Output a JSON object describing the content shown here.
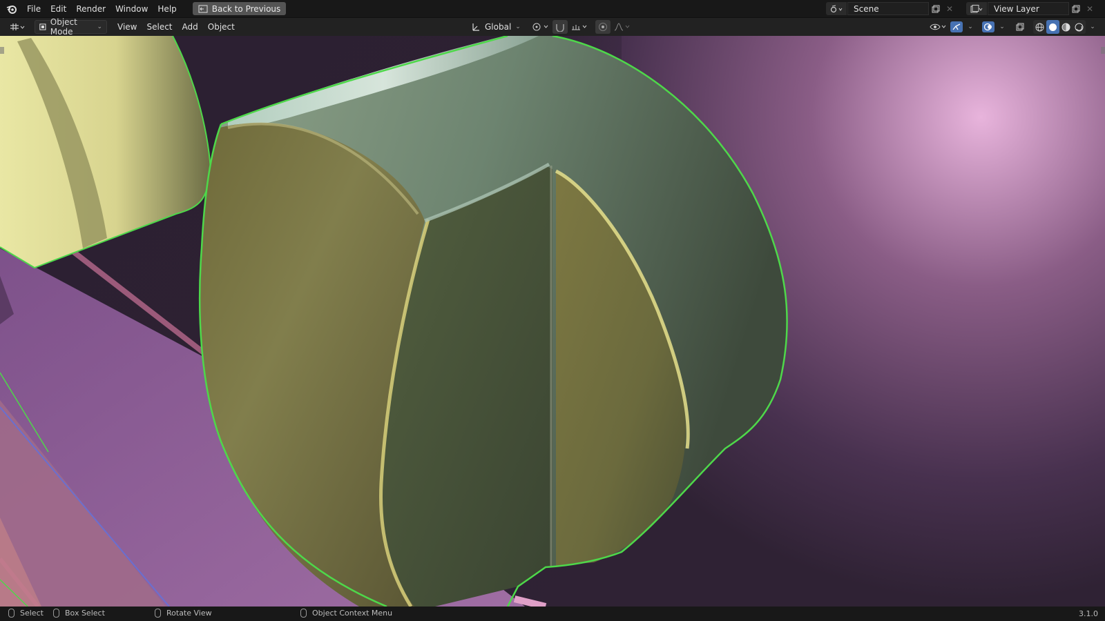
{
  "menu": {
    "items": [
      "File",
      "Edit",
      "Render",
      "Window",
      "Help"
    ],
    "back_label": "Back to Previous"
  },
  "scene": {
    "name": "Scene"
  },
  "view_layer": {
    "name": "View Layer"
  },
  "header": {
    "mode": "Object Mode",
    "menus": [
      "View",
      "Select",
      "Add",
      "Object"
    ],
    "orientation": "Global"
  },
  "status": {
    "select": "Select",
    "box_select": "Box Select",
    "rotate_view": "Rotate View",
    "context_menu": "Object Context Menu",
    "version": "3.1.0"
  },
  "colors": {
    "selection_outline": "#4ed84a",
    "accent": "#4772b3",
    "background_purple": "#5a3f63"
  }
}
